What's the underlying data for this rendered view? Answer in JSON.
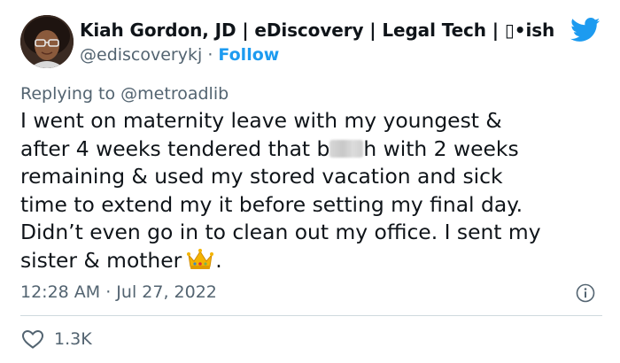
{
  "author": {
    "name": "Kiah Gordon, JD | eDiscovery | Legal Tech | ▯•ish",
    "handle": "@ediscoverykj",
    "separator": "·",
    "follow_label": "Follow"
  },
  "reply": {
    "prefix": "Replying to",
    "target": "@metroadlib"
  },
  "tweet": {
    "line1": "I went on maternity leave with my youngest &",
    "line2_a": "after 4 weeks tendered that b",
    "line2_b": "h with 2 weeks",
    "line3": "remaining & used my stored vacation and sick",
    "line4": "time to extend my it before setting my final day.",
    "line5": "Didn’t even go in to clean out my office. I sent my",
    "line6_a": "sister & mother",
    "line6_b": "."
  },
  "meta": {
    "timestamp": "12:28 AM · Jul 27, 2022"
  },
  "actions": {
    "like_count": "1.3K"
  },
  "icons": {
    "brand": "twitter-bird-icon",
    "info": "info-icon",
    "like": "heart-icon",
    "emoji": "crown-emoji"
  },
  "colors": {
    "brand_blue": "#1d9bf0",
    "text": "#0f1419",
    "secondary": "#536471",
    "divider": "#cfd9de"
  }
}
